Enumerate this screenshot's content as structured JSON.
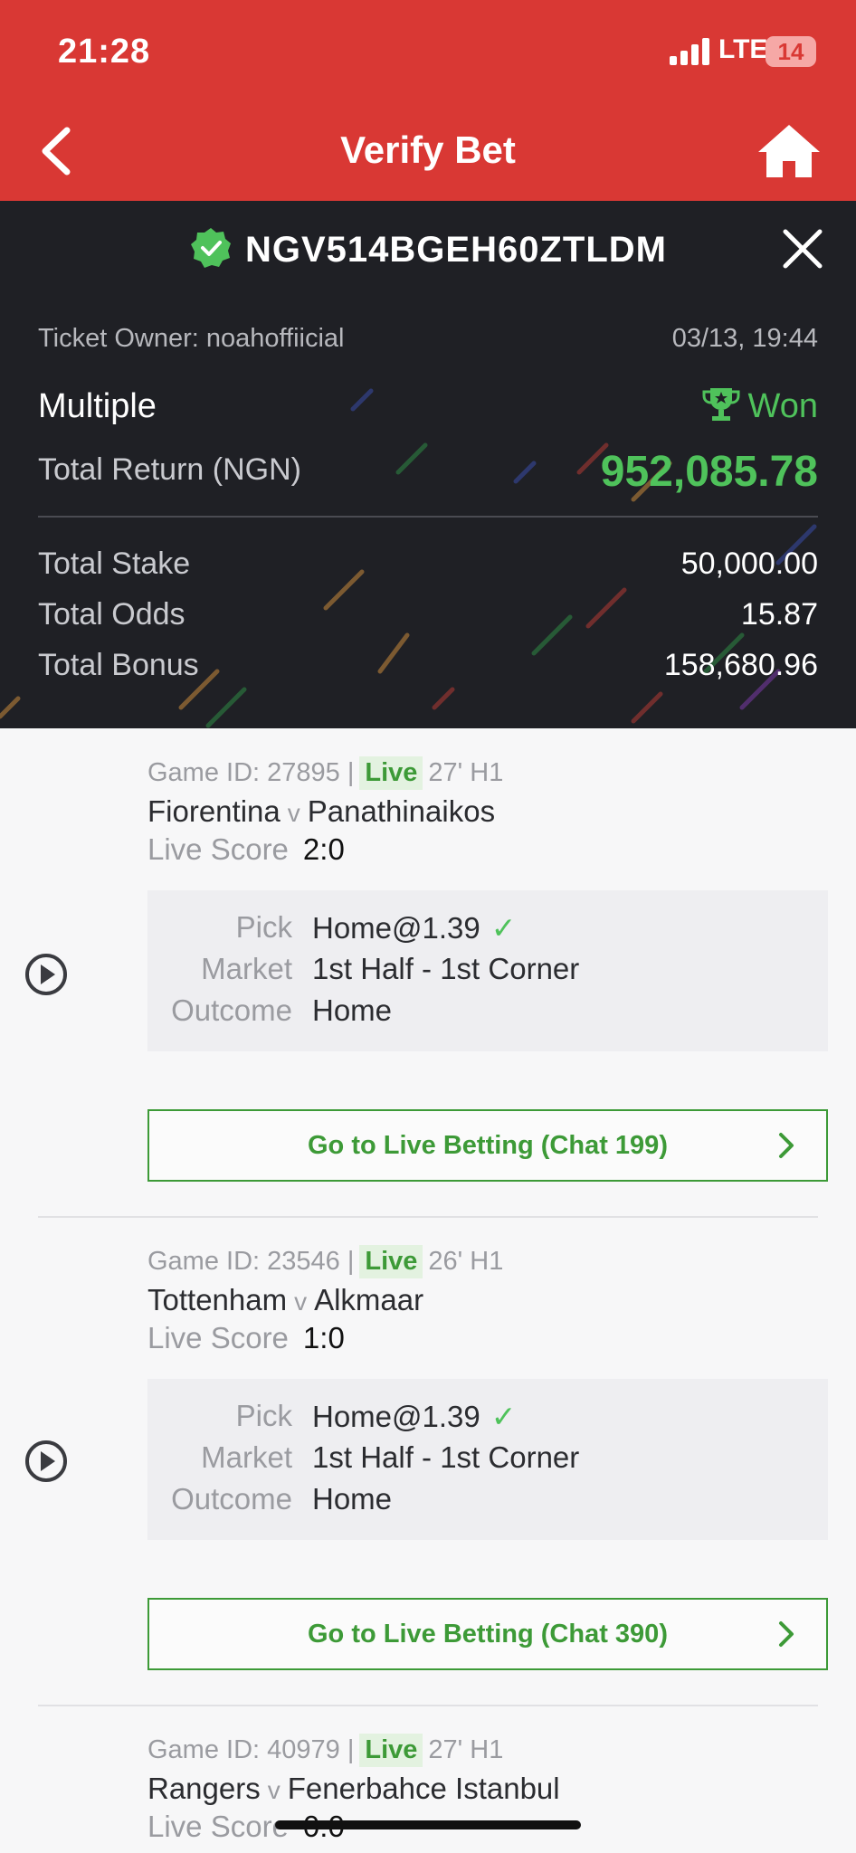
{
  "status_bar": {
    "time": "21:28",
    "network": "LTE",
    "battery": "14"
  },
  "nav": {
    "title": "Verify Bet",
    "back_icon": "chevron-left-icon",
    "home_icon": "home-icon"
  },
  "ticket": {
    "code": "NGV514BGEH60ZTLDM",
    "owner": "Ticket Owner: noahoffiicial",
    "datetime": "03/13, 19:44",
    "type": "Multiple",
    "status": "Won",
    "total_return_label": "Total Return (NGN)",
    "total_return": "952,085.78",
    "total_stake_label": "Total Stake",
    "total_stake": "50,000.00",
    "total_odds_label": "Total Odds",
    "total_odds": "15.87",
    "total_bonus_label": "Total Bonus",
    "total_bonus": "158,680.96"
  },
  "colors": {
    "brand_red": "#d93834",
    "won_green": "#4fc25b",
    "dark_panel": "#1f2025"
  },
  "labels": {
    "pick": "Pick",
    "market": "Market",
    "outcome": "Outcome",
    "live_score": "Live Score",
    "live": "Live",
    "vs": "v"
  },
  "games": [
    {
      "game_id": "Game ID: 27895 |",
      "time": "27' H1",
      "home": "Fiorentina",
      "away": "Panathinaikos",
      "score": "2:0",
      "pick": "Home@1.39",
      "market": "1st Half - 1st Corner",
      "outcome": "Home",
      "cta": "Go to Live Betting (Chat 199)"
    },
    {
      "game_id": "Game ID: 23546 |",
      "time": "26' H1",
      "home": "Tottenham",
      "away": "Alkmaar",
      "score": "1:0",
      "pick": "Home@1.39",
      "market": "1st Half - 1st Corner",
      "outcome": "Home",
      "cta": "Go to Live Betting (Chat 390)"
    },
    {
      "game_id": "Game ID: 40979 |",
      "time": "27' H1",
      "home": "Rangers",
      "away": "Fenerbahce Istanbul",
      "score": "0:0"
    }
  ]
}
